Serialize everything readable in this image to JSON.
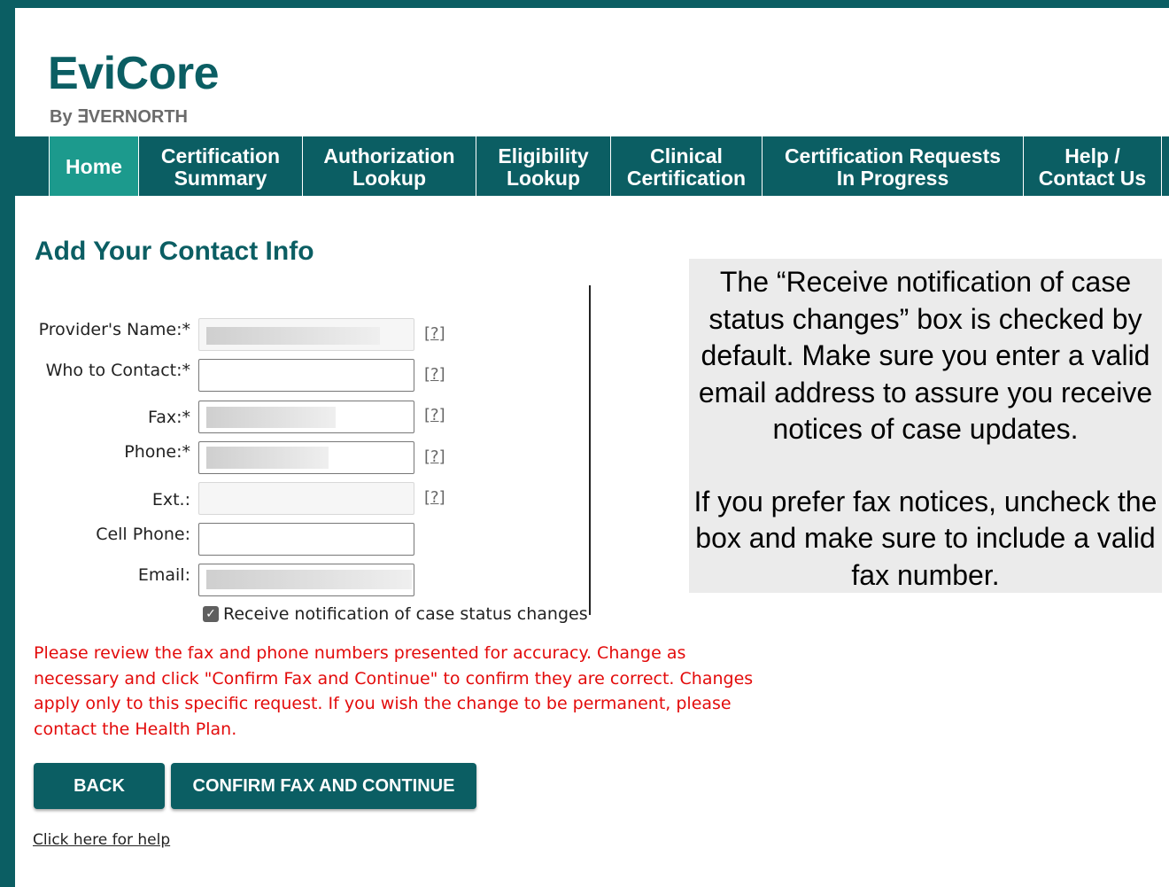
{
  "brand": {
    "name": "EviCore",
    "tagline": "By ∃VERNORTH"
  },
  "nav": [
    {
      "line1": "Home",
      "line2": ""
    },
    {
      "line1": "Certification",
      "line2": "Summary"
    },
    {
      "line1": "Authorization",
      "line2": "Lookup"
    },
    {
      "line1": "Eligibility",
      "line2": "Lookup"
    },
    {
      "line1": "Clinical",
      "line2": "Certification"
    },
    {
      "line1": "Certification Requests",
      "line2": "In Progress"
    },
    {
      "line1": "Help /",
      "line2": "Contact Us"
    }
  ],
  "form": {
    "title": "Add Your Contact Info",
    "fields": {
      "provider_name": {
        "label": "Provider's Name:*",
        "value": "",
        "help": "[?]"
      },
      "who_to_contact": {
        "label": "Who to Contact:*",
        "value": "",
        "help": "[?]"
      },
      "fax": {
        "label": "Fax:*",
        "value": "",
        "help": "[?]"
      },
      "phone": {
        "label": "Phone:*",
        "value": "",
        "help": "[?]"
      },
      "ext": {
        "label": "Ext.:",
        "value": "",
        "help": "[?]"
      },
      "cell_phone": {
        "label": "Cell Phone:",
        "value": ""
      },
      "email": {
        "label": "Email:",
        "value": ""
      }
    },
    "notify_checkbox": {
      "label": "Receive notification of case status changes",
      "checked": true
    },
    "warning": "Please review the fax and phone numbers presented for accuracy. Change as necessary and click \"Confirm Fax and Continue\" to confirm they are correct. Changes apply only to this specific request. If you wish the change to be permanent, please contact the Health Plan.",
    "buttons": {
      "back": "BACK",
      "confirm": "CONFIRM FAX AND CONTINUE"
    },
    "help_link": "Click here for help"
  },
  "callout": {
    "paragraph1": "The “Receive notification of case status changes” box is checked by default.  Make sure you enter a valid email address to assure you receive notices of case updates.",
    "paragraph2": "If you prefer fax notices, uncheck the box and make sure to include a valid fax number."
  },
  "colors": {
    "brand_teal": "#0b5e63",
    "active_tab": "#1c9a8d",
    "warning_red": "#e30b0b",
    "callout_bg": "#ebebeb"
  }
}
